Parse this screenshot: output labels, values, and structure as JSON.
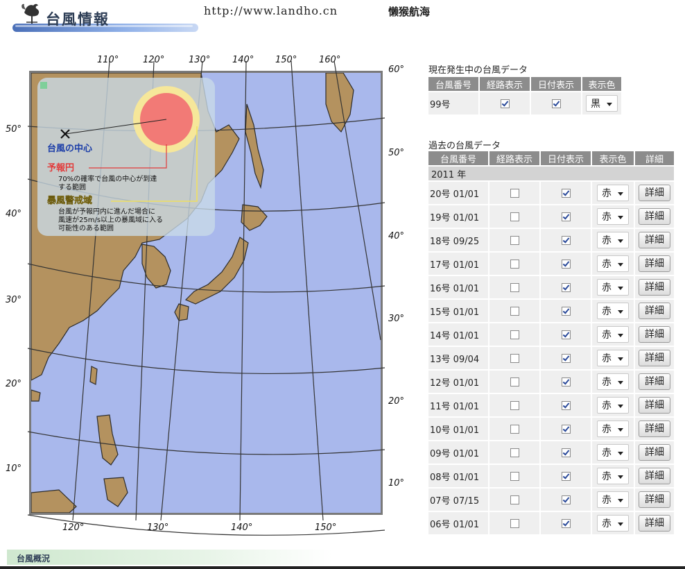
{
  "header": {
    "logo_title": "台風情報",
    "site_url": "http://www.landho.cn",
    "site_name": "懒猴航海"
  },
  "map": {
    "lon_labels_top": [
      "110°",
      "120°",
      "130°",
      "140°",
      "150°",
      "160°"
    ],
    "lon_labels_bottom": [
      "120°",
      "130°",
      "140°",
      "150°"
    ],
    "lat_labels_left": [
      "50°",
      "40°",
      "30°",
      "20°",
      "10°"
    ],
    "lat_labels_right": [
      "60°",
      "50°",
      "40°",
      "30°",
      "20°",
      "10°"
    ],
    "legend": {
      "center_label": "台風の中心",
      "forecast_title": "予報円",
      "forecast_desc1": "70%の確率で台風の中心が到達",
      "forecast_desc2": "する範囲",
      "storm_title": "暴風警戒域",
      "storm_desc1": "台風が予報円内に進んだ場合に",
      "storm_desc2": "風速が25m/s以上の暴風域に入る",
      "storm_desc3": "可能性のある範囲"
    },
    "colors": {
      "sea": "#a9b8ec",
      "land": "#b4925f",
      "forecast_circle": "#f27a76",
      "storm_ring": "#f6e79a"
    }
  },
  "current": {
    "title": "現在発生中の台風データ",
    "headers": [
      "台風番号",
      "経路表示",
      "日付表示",
      "表示色"
    ],
    "rows": [
      {
        "num": "99号",
        "route": true,
        "date": true,
        "color": "黒"
      }
    ]
  },
  "past": {
    "title": "過去の台風データ",
    "headers": [
      "台風番号",
      "経路表示",
      "日付表示",
      "表示色",
      "詳細"
    ],
    "year": "2011 年",
    "detail_label": "詳細",
    "rows": [
      {
        "num": "20号 01/01",
        "route": false,
        "date": true,
        "color": "赤"
      },
      {
        "num": "19号 01/01",
        "route": false,
        "date": true,
        "color": "赤"
      },
      {
        "num": "18号 09/25",
        "route": false,
        "date": true,
        "color": "赤"
      },
      {
        "num": "17号 01/01",
        "route": false,
        "date": true,
        "color": "赤"
      },
      {
        "num": "16号 01/01",
        "route": false,
        "date": true,
        "color": "赤"
      },
      {
        "num": "15号 01/01",
        "route": false,
        "date": true,
        "color": "赤"
      },
      {
        "num": "14号 01/01",
        "route": false,
        "date": true,
        "color": "赤"
      },
      {
        "num": "13号 09/04",
        "route": false,
        "date": true,
        "color": "赤"
      },
      {
        "num": "12号 01/01",
        "route": false,
        "date": true,
        "color": "赤"
      },
      {
        "num": "11号 01/01",
        "route": false,
        "date": true,
        "color": "赤"
      },
      {
        "num": "10号 01/01",
        "route": false,
        "date": true,
        "color": "赤"
      },
      {
        "num": "09号 01/01",
        "route": false,
        "date": true,
        "color": "赤"
      },
      {
        "num": "08号 01/01",
        "route": false,
        "date": true,
        "color": "赤"
      },
      {
        "num": "07号 07/15",
        "route": false,
        "date": true,
        "color": "赤"
      },
      {
        "num": "06号 01/01",
        "route": false,
        "date": true,
        "color": "赤"
      }
    ]
  },
  "footer": {
    "section_label": "台風概況"
  }
}
